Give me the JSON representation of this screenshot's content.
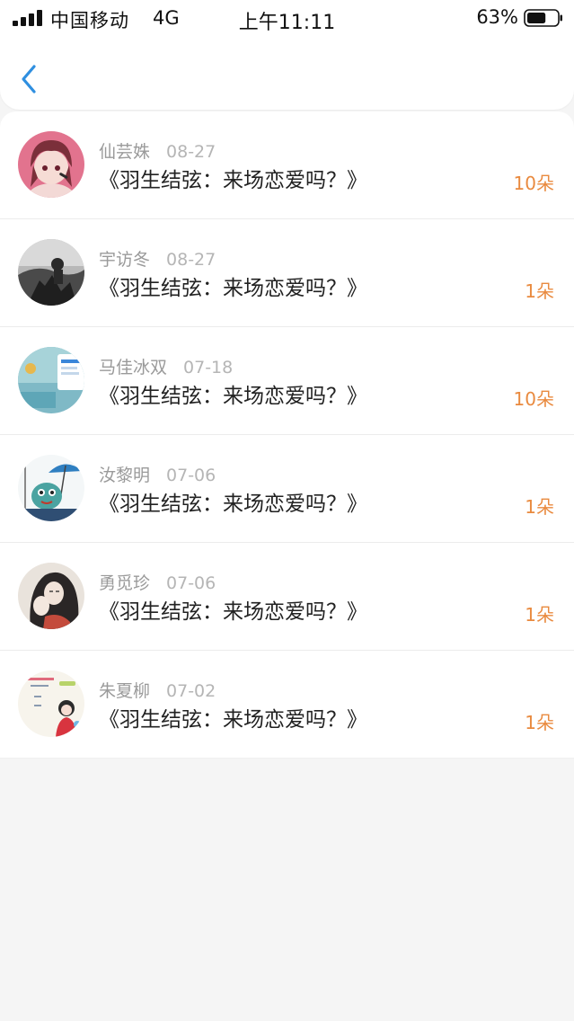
{
  "status_bar": {
    "carrier": "中国移动",
    "network": "4G",
    "time": "上午11:11",
    "battery": "63%",
    "battery_level": 0.63
  },
  "nav": {
    "back_icon": "chevron-left-icon",
    "accent_color": "#2f8fe0"
  },
  "items": [
    {
      "name": "仙芸姝",
      "date": "08-27",
      "title": "《羽生结弦：来场恋爱吗？》",
      "count": "10朵",
      "avatar": "avatar-anime-girl"
    },
    {
      "name": "宇访冬",
      "date": "08-27",
      "title": "《羽生结弦：来场恋爱吗？》",
      "count": "1朵",
      "avatar": "avatar-monochrome-photo"
    },
    {
      "name": "马佳冰双",
      "date": "07-18",
      "title": "《羽生结弦：来场恋爱吗？》",
      "count": "10朵",
      "avatar": "avatar-payment-screenshot"
    },
    {
      "name": "汝黎明",
      "date": "07-06",
      "title": "《羽生结弦：来场恋爱吗？》",
      "count": "1朵",
      "avatar": "avatar-cartoon-umbrella"
    },
    {
      "name": "勇觅珍",
      "date": "07-06",
      "title": "《羽生结弦：来场恋爱吗？》",
      "count": "1朵",
      "avatar": "avatar-ink-illustration"
    },
    {
      "name": "朱夏柳",
      "date": "07-02",
      "title": "《羽生结弦：来场恋爱吗？》",
      "count": "1朵",
      "avatar": "avatar-cute-drawing"
    }
  ],
  "colors": {
    "count": "#e98a3f",
    "name": "#9a9a9a",
    "title": "#222222",
    "background": "#f5f5f5"
  }
}
